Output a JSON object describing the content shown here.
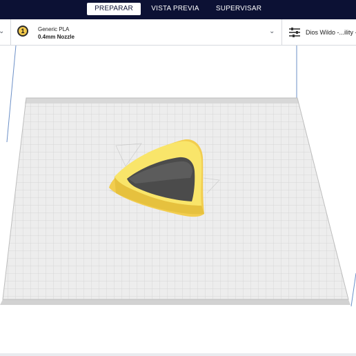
{
  "header": {
    "tabs": [
      {
        "label": "PREPARAR",
        "active": true
      },
      {
        "label": "VISTA PREVIA",
        "active": false
      },
      {
        "label": "SUPERVISAR",
        "active": false
      }
    ]
  },
  "material_bar": {
    "extruder_number": "1",
    "material": "Generic PLA",
    "nozzle": "0.4mm Nozzle",
    "profile": "Dios Wildo -...ility -",
    "icons": {
      "dropdown": "chevron-down-icon",
      "settings": "sliders-icon"
    }
  },
  "viewport": {
    "model": "triangular-cutter",
    "colors": {
      "model": "#f8e062",
      "plate": "#ededed",
      "grid": "#cfcfcf",
      "volume_edge": "#6b8fc7",
      "header": "#0c1134"
    }
  }
}
